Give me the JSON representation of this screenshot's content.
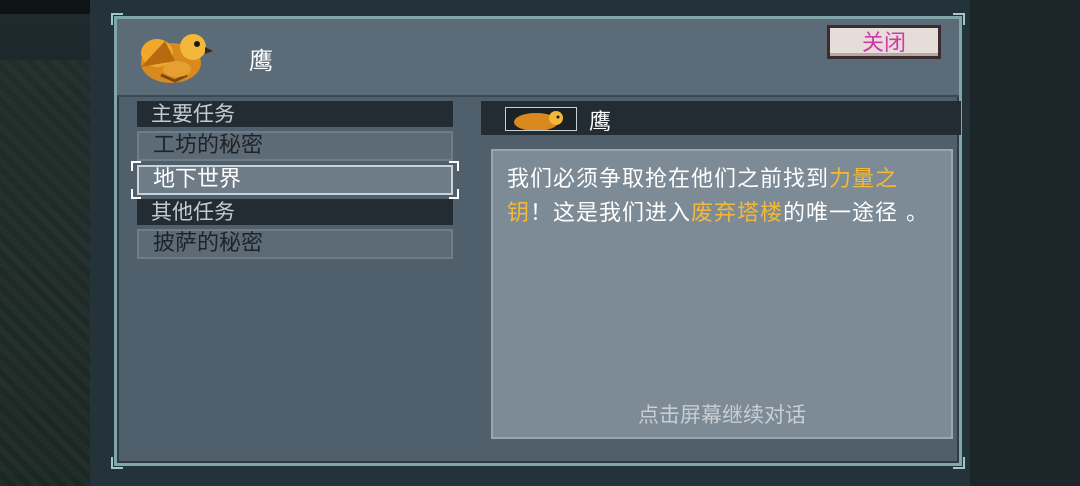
{
  "dialog": {
    "speaker": "鹰",
    "close_label": "关闭",
    "speaker_bar_name": "鹰",
    "continue_hint": "点击屏幕继续对话",
    "text_parts": [
      {
        "text": "我们必须争取抢在他们之前找到",
        "highlight": false
      },
      {
        "text": "力量之钥",
        "highlight": true
      },
      {
        "text": "！这是我们进入",
        "highlight": false
      },
      {
        "text": "废弃塔楼",
        "highlight": true
      },
      {
        "text": "的唯一途径 。",
        "highlight": false
      }
    ]
  },
  "quests": {
    "main_header": "主要任务",
    "main_items": [
      {
        "label": "工坊的秘密",
        "selected": false
      },
      {
        "label": "地下世界",
        "selected": true
      }
    ],
    "other_header": "其他任务",
    "other_items": [
      {
        "label": "披萨的秘密",
        "selected": false
      }
    ]
  },
  "colors": {
    "highlight": "#f2b83a",
    "close_text": "#cf3aa8",
    "frame": "#7fa6a9"
  }
}
